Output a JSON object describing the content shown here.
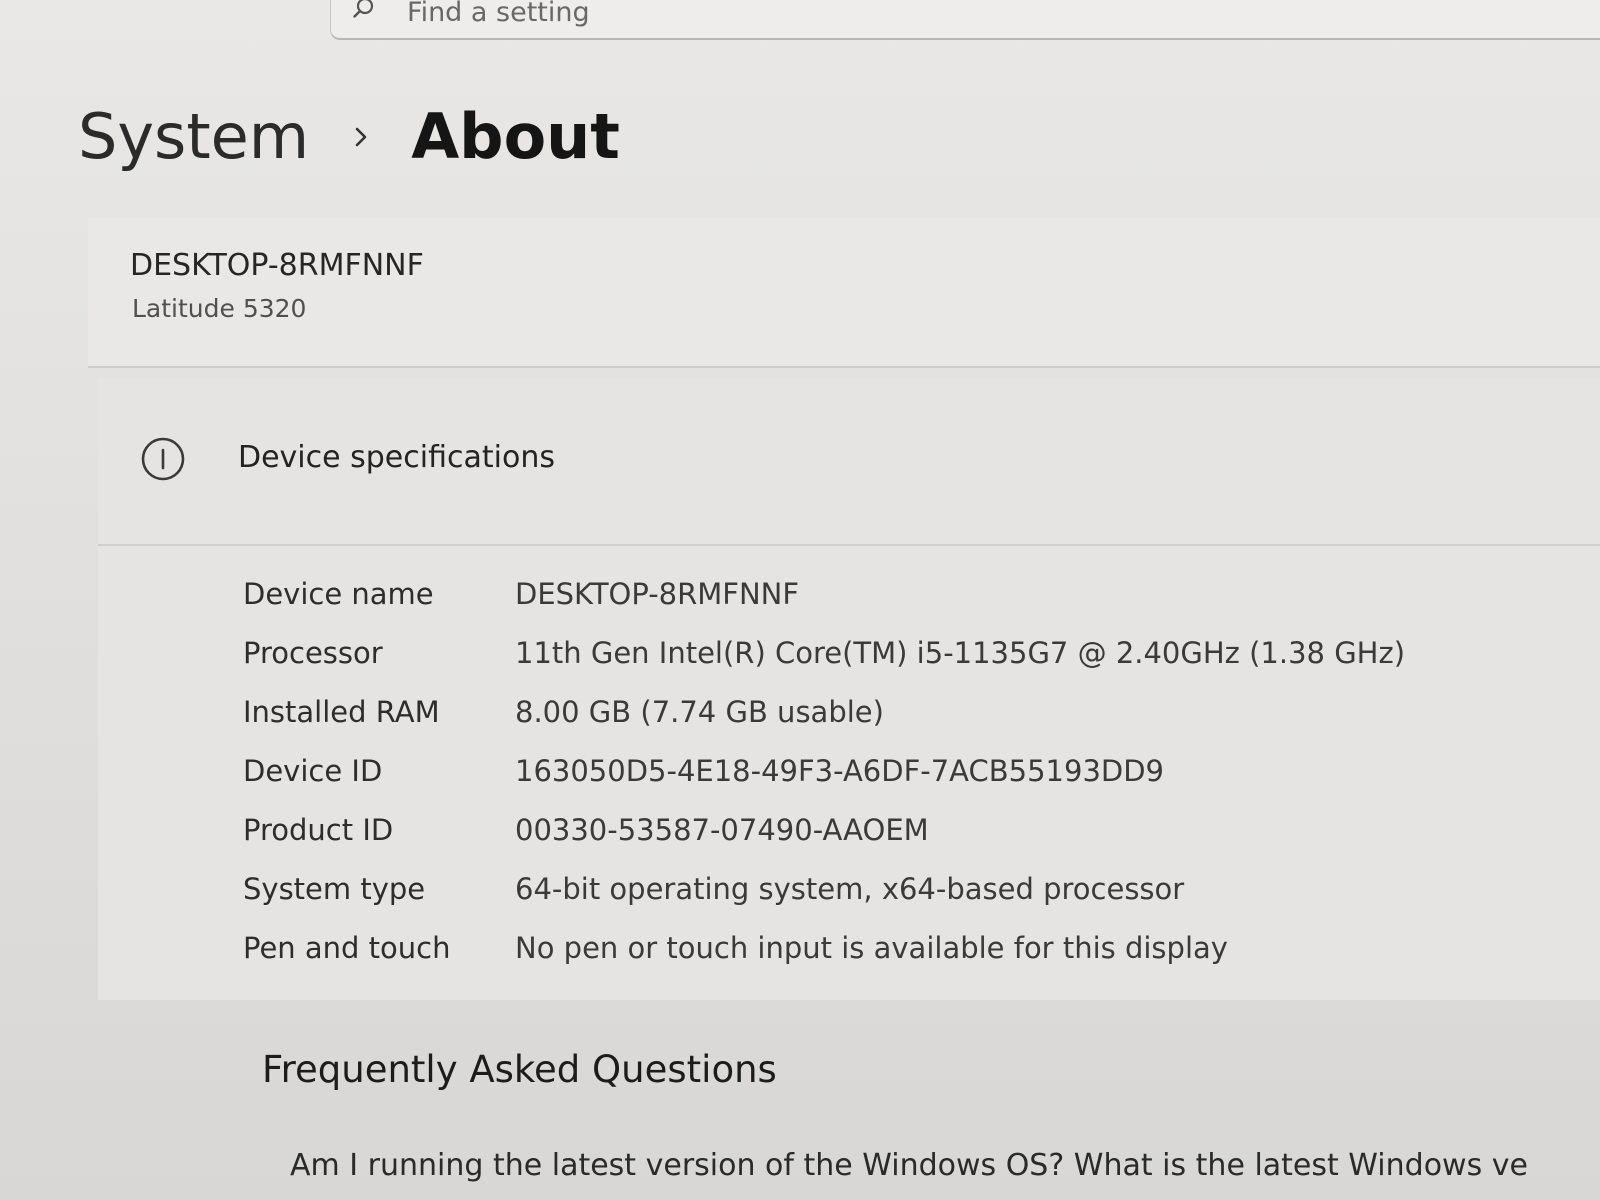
{
  "search": {
    "placeholder": "Find a setting",
    "icon": "search-icon"
  },
  "breadcrumb": {
    "parent": "System",
    "separator_icon": "chevron-right-icon",
    "current": "About"
  },
  "device": {
    "name": "DESKTOP-8RMFNNF",
    "model": "Latitude 5320"
  },
  "specs": {
    "icon": "info-icon",
    "title": "Device specifications",
    "rows": [
      {
        "label": "Device name",
        "value": "DESKTOP-8RMFNNF"
      },
      {
        "label": "Processor",
        "value": "11th Gen Intel(R) Core(TM) i5-1135G7 @ 2.40GHz (1.38 GHz)"
      },
      {
        "label": "Installed RAM",
        "value": "8.00 GB (7.74 GB usable)"
      },
      {
        "label": "Device ID",
        "value": "163050D5-4E18-49F3-A6DF-7ACB55193DD9"
      },
      {
        "label": "Product ID",
        "value": "00330-53587-07490-AAOEM"
      },
      {
        "label": "System type",
        "value": "64-bit operating system, x64-based processor"
      },
      {
        "label": "Pen and touch",
        "value": "No pen or touch input is available for this display"
      }
    ]
  },
  "faq": {
    "title": "Frequently Asked Questions",
    "question": "Am I running the latest version of the Windows OS? What is the latest Windows ve"
  }
}
